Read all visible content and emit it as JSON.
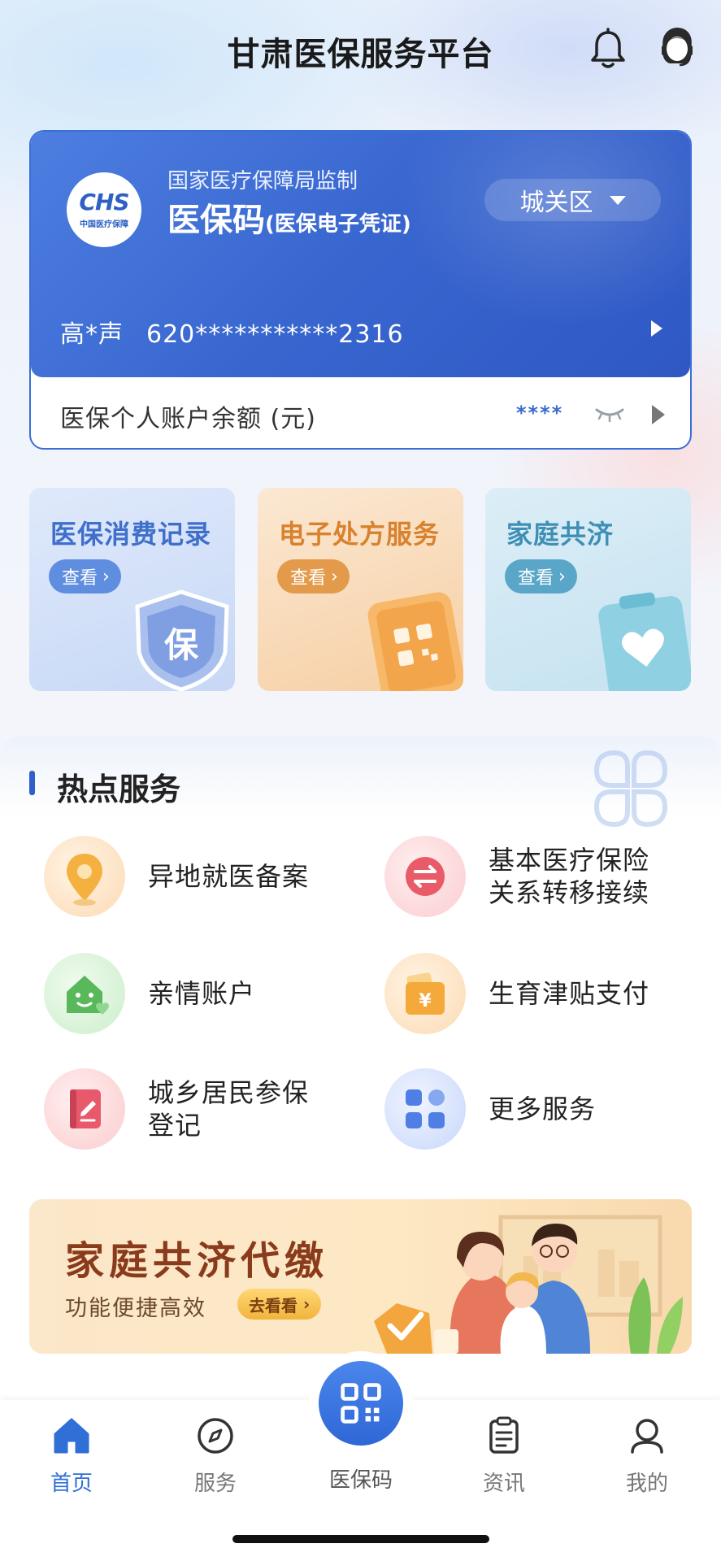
{
  "header": {
    "title": "甘肃医保服务平台",
    "icons": [
      "bell-icon",
      "customer-service-icon"
    ]
  },
  "card": {
    "logo_text": "CHS",
    "logo_sub": "中国医疗保障",
    "supervise": "国家医疗保障局监制",
    "name": "医保码",
    "name_sub": "(医保电子凭证)",
    "district": "城关区",
    "holder_name": "高*声",
    "holder_id": "620***********2316",
    "balance_label": "医保个人账户余额 (元)",
    "balance_value": "****",
    "colors": {
      "card_blue": "#3866cf",
      "balance_blue": "#3b6bd0"
    }
  },
  "tiles": [
    {
      "title": "医保消费记录",
      "button": "查看",
      "icon": "shield-bao-icon"
    },
    {
      "title": "电子处方服务",
      "button": "查看",
      "icon": "phone-qr-icon"
    },
    {
      "title": "家庭共济",
      "button": "查看",
      "icon": "heart-clipboard-icon"
    }
  ],
  "hot": {
    "title": "热点服务",
    "services": [
      {
        "label": "异地就医备案",
        "icon": "location-pin-icon"
      },
      {
        "label": "基本医疗保险关系转移接续",
        "icon": "transfer-icon"
      },
      {
        "label": "亲情账户",
        "icon": "family-account-icon"
      },
      {
        "label": "生育津贴支付",
        "icon": "yuan-wallet-icon"
      },
      {
        "label": "城乡居民参保登记",
        "icon": "registration-book-icon"
      },
      {
        "label": "更多服务",
        "icon": "grid-apps-icon"
      }
    ]
  },
  "banner": {
    "title": "家庭共济代缴",
    "subtitle": "功能便捷高效",
    "button": "去看看"
  },
  "nav": {
    "items": [
      {
        "label": "首页",
        "icon": "home-icon",
        "active": true
      },
      {
        "label": "服务",
        "icon": "compass-icon",
        "active": false
      },
      {
        "label": "医保码",
        "icon": "qr-code-icon",
        "active": false
      },
      {
        "label": "资讯",
        "icon": "clipboard-icon",
        "active": false
      },
      {
        "label": "我的",
        "icon": "user-icon",
        "active": false
      }
    ],
    "active_color": "#2f6fd6"
  }
}
